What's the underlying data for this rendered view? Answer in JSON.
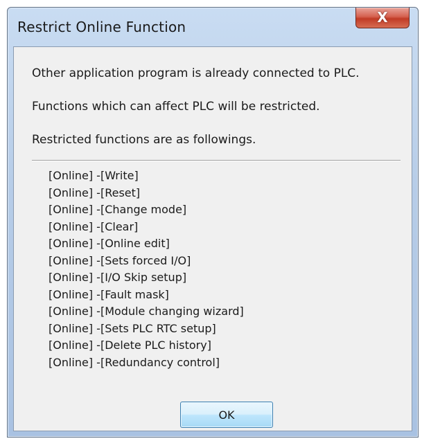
{
  "dialog": {
    "title": "Restrict Online Function",
    "close_icon": "X"
  },
  "messages": [
    "Other application program is already connected to PLC.",
    "Functions which can affect PLC will be restricted.",
    "Restricted functions are as followings."
  ],
  "restricted_functions": [
    "[Online] -[Write]",
    "[Online] -[Reset]",
    "[Online] -[Change mode]",
    "[Online] -[Clear]",
    "[Online] -[Online edit]",
    "[Online] -[Sets forced I/O]",
    "[Online] -[I/O Skip setup]",
    "[Online] -[Fault mask]",
    "[Online] -[Module changing wizard]",
    "[Online] -[Sets PLC RTC setup]",
    "[Online] -[Delete PLC history]",
    "[Online] -[Redundancy control]"
  ],
  "buttons": {
    "ok_label": "OK"
  }
}
